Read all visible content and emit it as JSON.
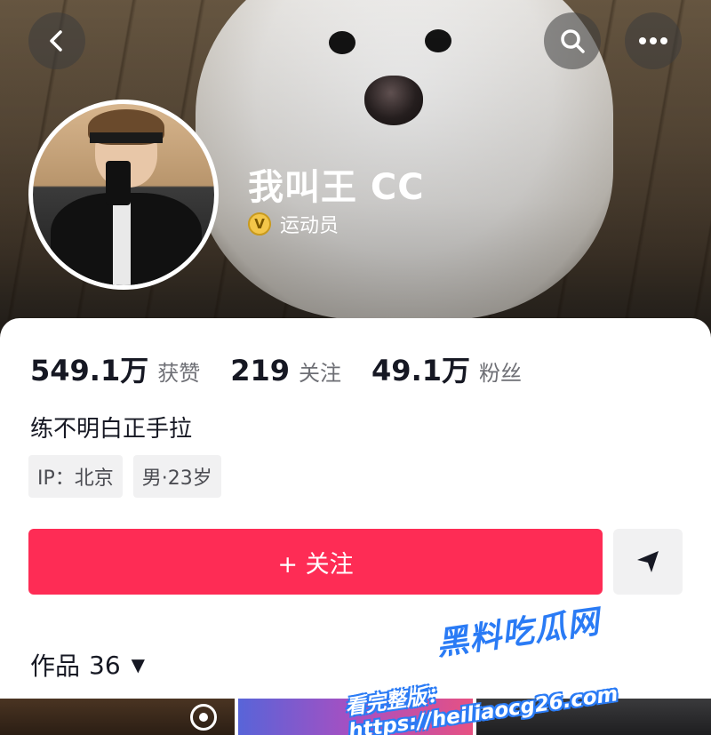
{
  "header": {
    "icons": {
      "back": "chevron-left-icon",
      "search": "search-icon",
      "more": "more-icon"
    }
  },
  "profile": {
    "name": "我叫王 CC",
    "badge_icon": "verified-v-icon",
    "badge_label": "运动员"
  },
  "stats": [
    {
      "value": "549.1万",
      "label": "获赞"
    },
    {
      "value": "219",
      "label": "关注"
    },
    {
      "value": "49.1万",
      "label": "粉丝"
    }
  ],
  "bio": "练不明白正手拉",
  "tags": [
    "IP：北京",
    "男·23岁"
  ],
  "actions": {
    "follow_label": "+ 关注",
    "share_icon": "send-icon"
  },
  "works": {
    "label": "作品",
    "count": "36"
  },
  "watermark": {
    "line1": "黑料吃瓜网",
    "line2": "看完整版：https://heiliaocg26.com"
  },
  "colors": {
    "accent": "#fe2c55",
    "badge": "#f3c64a",
    "watermark": "#2a7bf5"
  }
}
